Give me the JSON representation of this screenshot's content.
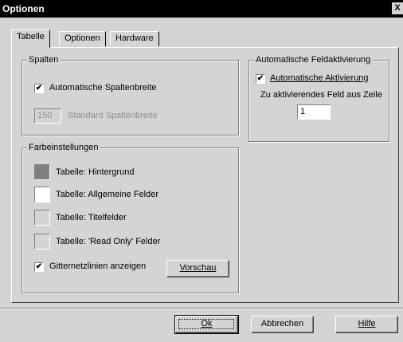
{
  "window": {
    "title": "Optionen",
    "close_label": "X"
  },
  "tabs": [
    {
      "label": "Tabelle",
      "active": true
    },
    {
      "label": "Optionen",
      "active": false
    },
    {
      "label": "Hardware",
      "active": false
    }
  ],
  "spalten": {
    "legend": "Spalten",
    "auto_width_label": "Automatische Spaltenbreite",
    "auto_width_checked": true,
    "std_width_value": "150",
    "std_width_label": "Standard Spaltenbreite"
  },
  "feldaktivierung": {
    "legend": "Automatische Feldaktivierung",
    "auto_activation_label": "Automatische Aktivierung",
    "auto_activation_checked": true,
    "row_label": "Zu aktivierendes Feld aus Zeile",
    "row_value": "1"
  },
  "farben": {
    "legend": "Farbeinstellungen",
    "items": [
      {
        "label": "Tabelle: Hintergrund",
        "color": "#808080"
      },
      {
        "label": "Tabelle: Allgemeine Felder",
        "color": "#ffffff"
      },
      {
        "label": "Tabelle: Titelfelder",
        "color": "#d4d4d4"
      },
      {
        "label": "Tabelle: 'Read Only' Felder",
        "color": "#d4d4d4"
      }
    ],
    "gridlines_label": "Gitternetzlinien anzeigen",
    "gridlines_checked": true,
    "preview_button": "Vorschau"
  },
  "buttons": {
    "ok": "Ok",
    "cancel": "Abbrechen",
    "help": "Hilfe"
  }
}
